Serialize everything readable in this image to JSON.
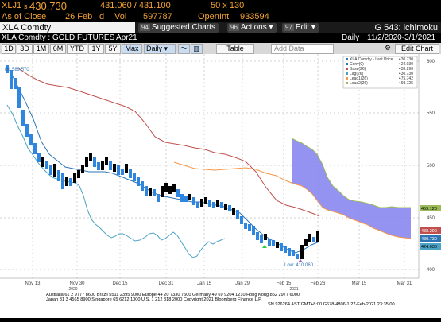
{
  "header": {
    "ticker": "XLJ1",
    "last_prefix": "s",
    "last_price": "430.730",
    "bid_ask": "431.060 / 431.100",
    "size": "50 x 130",
    "close_label": "As of Close",
    "close_date": "26 Feb",
    "close_suffix": "d",
    "vol_label": "Vol",
    "volume": "597787",
    "oi_label": "OpenInt",
    "open_interest": "933594"
  },
  "toolbar": {
    "security_name": "XLA Comdty",
    "suggested_num": "94",
    "suggested_label": "Suggested Charts",
    "actions_num": "96",
    "actions_label": "Actions",
    "edit_num": "97",
    "edit_label": "Edit",
    "chart_id": "G 543: ichimoku"
  },
  "subheader": {
    "name": "XLA Comdty : GOLD FUTURES",
    "contract": "Apr21",
    "frequency": "Daily",
    "date_range": "11/2/2020-3/1/2021"
  },
  "period_buttons": [
    "1D",
    "3D",
    "1M",
    "6M",
    "YTD",
    "1Y",
    "5Y",
    "Max"
  ],
  "controls": {
    "frequency_select": "Daily",
    "table_label": "Table",
    "add_data_placeholder": "Add Data",
    "edit_chart_label": "Edit Chart"
  },
  "legend": {
    "title": "XLA Comdty - Last Price",
    "title_value": "430.730",
    "items": [
      {
        "label": "Conv(9)",
        "value": "424.030",
        "color": "#2e75b6"
      },
      {
        "label": "Base(26)",
        "value": "438.290",
        "color": "#c0504d"
      },
      {
        "label": "Lag(26)",
        "value": "430.730",
        "color": "#4aa3c4"
      },
      {
        "label": "Lead1(26)",
        "value": "475.742",
        "color": "#f79646"
      },
      {
        "label": "Lead2(26)",
        "value": "498.725",
        "color": "#9bbb59"
      }
    ]
  },
  "annotations": {
    "high": "Hi: 589.570",
    "low": "Low: 410.060"
  },
  "y_axis": {
    "ticks": [
      "600",
      "550",
      "500",
      "450",
      "400"
    ],
    "tags": [
      {
        "value": "459.120",
        "color": "#9bbb59"
      },
      {
        "value": "438.290",
        "color": "#c0504d"
      },
      {
        "value": "430.730",
        "color": "#2e75b6"
      },
      {
        "value": "424.030",
        "color": "#4aa3c4"
      }
    ]
  },
  "x_axis": {
    "ticks": [
      "Nov 13",
      "Nov 30",
      "Dec 15",
      "Dec 31",
      "Jan 15",
      "Jan 29",
      "Feb 15",
      "Feb 26",
      "Mar 15",
      "Mar 31"
    ],
    "years": [
      "2020",
      "2021"
    ]
  },
  "footer": {
    "line1": "Australia 61 2 9777 8600  Brazil 5511 2395 9000  Europe 44 20 7330 7500  Germany 49 69 9204 1210  Hong Kong 852 2977 6000",
    "line2": "Japan 81 3 4565 8900        Singapore 65 6212 1000        U.S. 1 212 318 2000           Copyright 2021 Bloomberg Finance L.P.",
    "line3": "SN 926264 AST  GMT+8:00 G678-4806-1 27-Feb-2021 23:35:00"
  },
  "colors": {
    "accent_orange": "#f4a236",
    "candle_up": "#2e86de",
    "candle_down": "#000000",
    "cloud": "#8a87f0"
  }
}
